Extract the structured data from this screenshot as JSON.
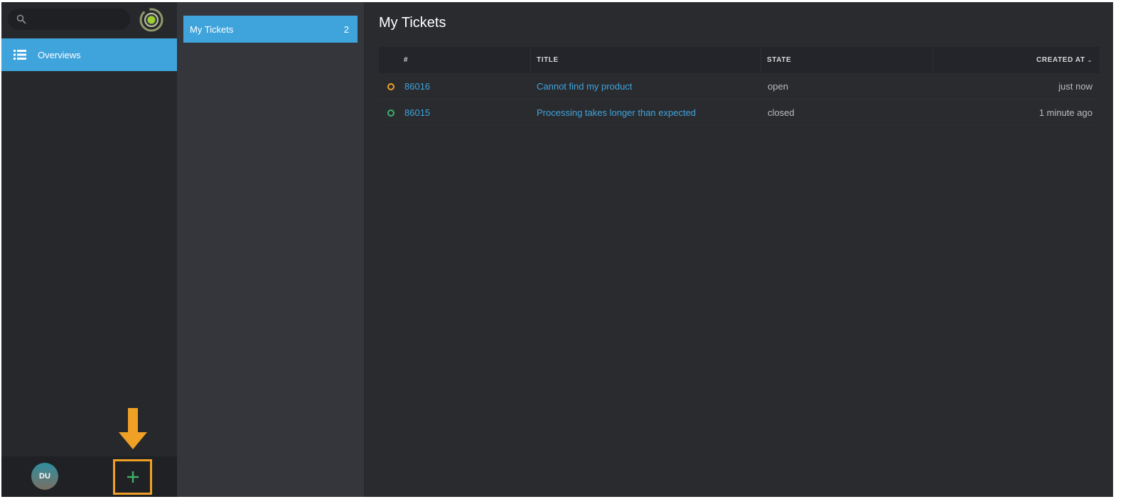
{
  "nav": {
    "search": {
      "placeholder": ""
    },
    "items": [
      {
        "label": "Overviews",
        "icon": "list-icon"
      }
    ],
    "user": {
      "initials": "DU"
    },
    "new_button": {
      "icon": "plus-icon"
    }
  },
  "overviews": {
    "items": [
      {
        "label": "My Tickets",
        "count": "2"
      }
    ]
  },
  "main": {
    "title": "My Tickets",
    "columns": {
      "number": "#",
      "title": "TITLE",
      "state": "STATE",
      "created_at": "CREATED AT"
    },
    "rows": [
      {
        "number": "86016",
        "title": "Cannot find my product",
        "state": "open",
        "created": "just now",
        "status_color": "#f0a024"
      },
      {
        "number": "86015",
        "title": "Processing takes longer than expected",
        "state": "closed",
        "created": "1 minute ago",
        "status_color": "#3bb36a"
      }
    ]
  },
  "colors": {
    "accent": "#3fa4dc",
    "highlight": "#f0a024",
    "nav_bg": "#27282c",
    "main_bg": "#2a2b2f"
  }
}
